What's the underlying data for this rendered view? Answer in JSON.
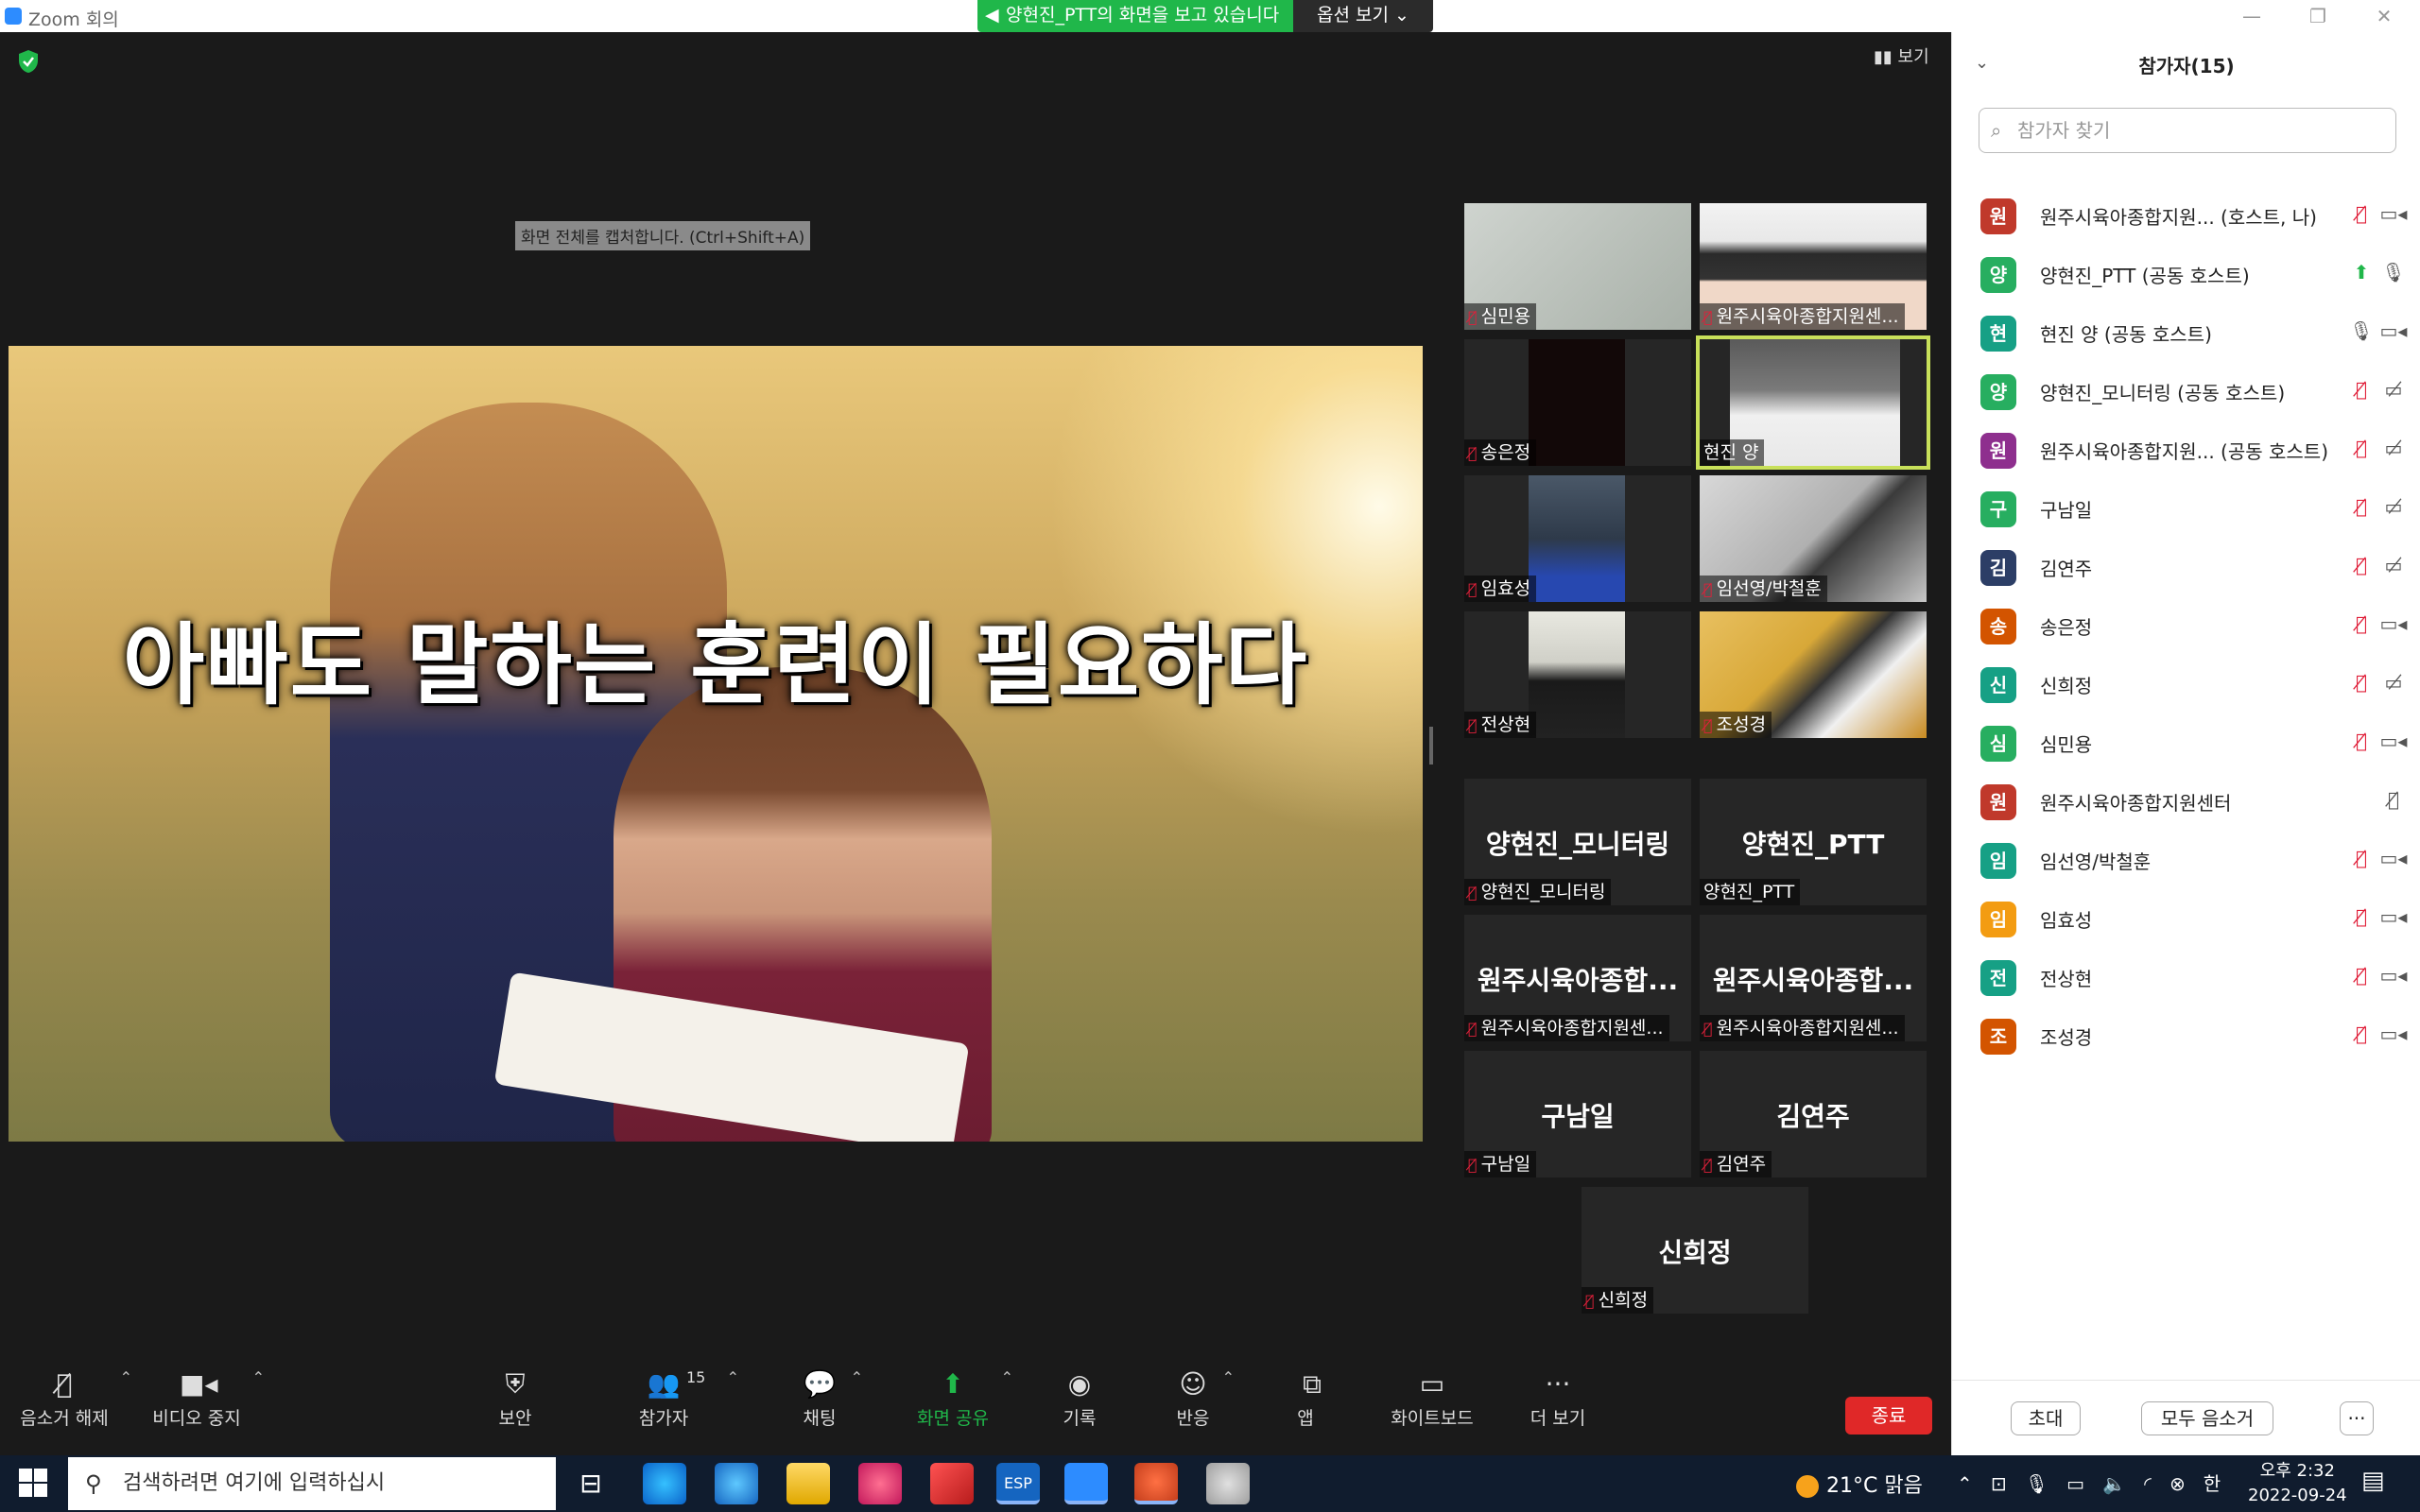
{
  "window": {
    "title": "Zoom 회의",
    "minimize": "—",
    "restore": "❐",
    "close": "✕"
  },
  "banner": {
    "text": "양현진_PTT의 화면을 보고 있습니다",
    "options": "옵션 보기 ⌄"
  },
  "view_btn": "▮▮ 보기",
  "capture_tip": "화면 전체를 캡처합니다. (Ctrl+Shift+A)",
  "slide": {
    "title": "아빠도 말하는 훈련이 필요하다"
  },
  "tiles": [
    {
      "label": "심민용"
    },
    {
      "label": "원주시육아종합지원센..."
    },
    {
      "label": "송은정"
    },
    {
      "label": "현진 양"
    },
    {
      "label": "임효성"
    },
    {
      "label": "임선영/박철훈"
    },
    {
      "label": "전상현"
    },
    {
      "label": "조성경"
    },
    {
      "big": "양현진_모니터링",
      "label": "양현진_모니터링"
    },
    {
      "big": "양현진_PTT",
      "label": "양현진_PTT"
    },
    {
      "big": "원주시육아종합...",
      "label": "원주시육아종합지원센..."
    },
    {
      "big": "원주시육아종합...",
      "label": "원주시육아종합지원센..."
    },
    {
      "big": "구남일",
      "label": "구남일"
    },
    {
      "big": "김연주",
      "label": "김연주"
    },
    {
      "big": "신희정",
      "label": "신희정"
    }
  ],
  "toolbar": {
    "unmute": "음소거 해제",
    "video": "비디오 중지",
    "security": "보안",
    "participants": "참가자",
    "participants_count": "15",
    "chat": "채팅",
    "share": "화면 공유",
    "record": "기록",
    "reactions": "반응",
    "apps": "앱",
    "whiteboard": "화이트보드",
    "more": "더 보기",
    "end": "종료"
  },
  "panel": {
    "title": "참가자(15)",
    "search_placeholder": "참가자 찾기",
    "participants": [
      {
        "initial": "원",
        "name": "원주시육아종합지원...    (호스트, 나)",
        "color": "#c0392b"
      },
      {
        "initial": "양",
        "name": "양현진_PTT (공동 호스트)",
        "color": "#27ae60"
      },
      {
        "initial": "현",
        "name": "현진 양 (공동 호스트)",
        "color": "#16a085"
      },
      {
        "initial": "양",
        "name": "양현진_모니터링 (공동 호스트)",
        "color": "#27ae60"
      },
      {
        "initial": "원",
        "name": "원주시육아종합지원... (공동 호스트)",
        "color": "#8e2f8e"
      },
      {
        "initial": "구",
        "name": "구남일",
        "color": "#27ae60"
      },
      {
        "initial": "김",
        "name": "김연주",
        "color": "#2c3e66"
      },
      {
        "initial": "송",
        "name": "송은정",
        "color": "#d35400"
      },
      {
        "initial": "신",
        "name": "신희정",
        "color": "#16a085"
      },
      {
        "initial": "심",
        "name": "심민용",
        "color": "#27ae60"
      },
      {
        "initial": "원",
        "name": "원주시육아종합지원센터",
        "color": "#c0392b"
      },
      {
        "initial": "임",
        "name": "임선영/박철훈",
        "color": "#16a085"
      },
      {
        "initial": "임",
        "name": "임효성",
        "color": "#f39c12"
      },
      {
        "initial": "전",
        "name": "전상현",
        "color": "#16a085"
      },
      {
        "initial": "조",
        "name": "조성경",
        "color": "#d35400"
      }
    ],
    "invite": "초대",
    "mute_all": "모두 음소거",
    "more": "···"
  },
  "taskbar": {
    "search_placeholder": "검색하려면 여기에 입력하십시",
    "weather": "21°C 맑음",
    "time": "오후 2:32",
    "date": "2022-09-24",
    "ime": "한",
    "esp": "ESP"
  }
}
